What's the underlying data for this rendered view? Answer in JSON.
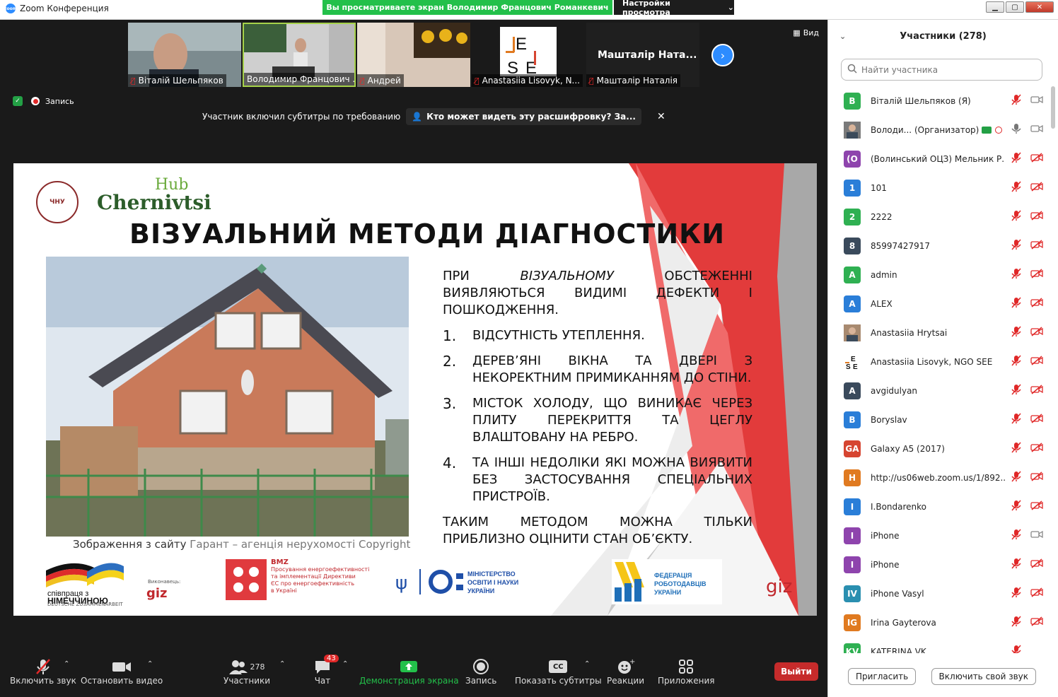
{
  "window": {
    "title": "Zoom Конференция",
    "share_banner": "Вы просматриваете экран Володимир Францович Романкевич",
    "view_settings": "Настройки просмотра"
  },
  "gallery": {
    "thumbs": [
      {
        "name": "Віталій Шельпяков",
        "muted": true
      },
      {
        "name": "Володимир Францович ...",
        "muted": false
      },
      {
        "name": "Андрей",
        "muted": true
      },
      {
        "name": "Anastasiia Lisovyk, N...",
        "muted": true
      },
      {
        "name": "Машталір Наталія",
        "muted": true,
        "big_label": "Машталір Ната..."
      }
    ],
    "view_label": "Вид"
  },
  "status": {
    "recording": "Запись",
    "subtitles_notice": "Участник включил субтитры по требованию",
    "subtitles_link": "Кто может видеть эту расшифровку? За..."
  },
  "slide": {
    "uni_logo_text": "ЧНУ",
    "hub_text": "Hub",
    "city_text": "Chernivtsi",
    "title": "ВІЗУАЛЬНИЙ МЕТОДИ ДІАГНОСТИКИ",
    "intro_pre": "ПРИ ",
    "intro_italic": "ВІЗУАЛЬНОМУ",
    "intro_post": " ОБСТЕЖЕННІ ВИЯВЛЯЮТЬСЯ ВИДИМІ ДЕФЕКТИ І ПОШКОДЖЕННЯ.",
    "items": [
      {
        "num": "1.",
        "text": "ВІДСУТНІСТЬ УТЕПЛЕННЯ."
      },
      {
        "num": "2.",
        "text": "ДЕРЕВ’ЯНІ ВІКНА ТА ДВЕРІ З НЕКОРЕКТНИМ ПРИМИКАННЯМ ДО СТІНИ."
      },
      {
        "num": "3.",
        "text": "МІСТОК ХОЛОДУ, ЩО ВИНИКАЄ ЧЕРЕЗ ПЛИТУ ПЕРЕКРИТТЯ ТА ЦЕГЛУ ВЛАШТОВАНУ НА РЕБРО."
      },
      {
        "num": "4.",
        "text": "ТА ІНШІ НЕДОЛІКИ ЯКІ МОЖНА ВИЯВИТИ БЕЗ ЗАСТОСУВАННЯ СПЕЦІАЛЬНИХ ПРИСТРОЇВ."
      }
    ],
    "conclusion": "ТАКИМ МЕТОДОМ МОЖНА ТІЛЬКИ ПРИБЛИЗНО ОЦІНИТИ СТАН ОБ’ЄКТУ.",
    "caption_prefix": "Зображення з сайту ",
    "caption_source": "Гарант – агенція нерухомості Copyright",
    "logos": {
      "coop_line1": "співпраця з",
      "coop_line2": "НІМЕЧЧИНОЮ",
      "coop_line3": "DEUTSCHE ZUSAMMENARBEIT",
      "giz_label": "Виконавець:",
      "giz": "giz",
      "bmz_title": "BMZ",
      "bmz_line1": "Просування енергоефективності",
      "bmz_line2": "та імплементації Директиви",
      "bmz_line3": "ЄС про енергоефективність",
      "bmz_line4": "в Україні",
      "mon_line1": "МІНІСТЕРСТВО",
      "mon_line2": "ОСВІТИ І НАУКИ",
      "mon_line3": "УКРАЇНИ",
      "fed_line1": "ФЕДЕРАЦІЯ",
      "fed_line2": "РОБОТОДАВЦІВ",
      "fed_line3": "УКРАЇНИ",
      "giz_corner": "giz"
    }
  },
  "toolbar": {
    "unmute": "Включить звук",
    "stop_video": "Остановить видео",
    "participants_count": "278",
    "participants": "Участники",
    "chat_badge": "43",
    "chat": "Чат",
    "share": "Демонстрация экрана",
    "record": "Запись",
    "cc_icon": "CC",
    "subtitles": "Показать субтитры",
    "reactions": "Реакции",
    "apps": "Приложения",
    "leave": "Выйти"
  },
  "participants_panel": {
    "title": "Участники (278)",
    "search_placeholder": "Найти участника",
    "invite": "Пригласить",
    "unmute_me": "Включить свой звук",
    "list": [
      {
        "initials": "В",
        "color": "#2fb052",
        "name": "Віталій Шельпяков (Я)",
        "mic": "muted",
        "video": "on"
      },
      {
        "initials": "",
        "color": "#7a7a7a",
        "name": "Володи... (Организатор)",
        "mic": "on",
        "video": "on",
        "photo": true
      },
      {
        "initials": "(О",
        "color": "#8e44ad",
        "name": "(Волинський ОЦЗ) Мельник Р...",
        "mic": "muted",
        "video": "off"
      },
      {
        "initials": "1",
        "color": "#2a7ed8",
        "name": "101",
        "mic": "muted",
        "video": "off"
      },
      {
        "initials": "2",
        "color": "#2fb052",
        "name": "2222",
        "mic": "muted",
        "video": "off"
      },
      {
        "initials": "8",
        "color": "#3a4a5c",
        "name": "85997427917",
        "mic": "muted",
        "video": "off"
      },
      {
        "initials": "A",
        "color": "#2fb052",
        "name": "admin",
        "mic": "muted",
        "video": "off"
      },
      {
        "initials": "A",
        "color": "#2a7ed8",
        "name": "ALEX",
        "mic": "muted",
        "video": "off"
      },
      {
        "initials": "",
        "color": "#a88a70",
        "name": "Anastasiia Hrytsai",
        "mic": "muted",
        "video": "off",
        "photo": true
      },
      {
        "initials": "",
        "color": "#ffffff",
        "name": "Anastasiia Lisovyk, NGO SEE",
        "mic": "muted",
        "video": "off",
        "logo": true
      },
      {
        "initials": "A",
        "color": "#3a4a5c",
        "name": "avgidulyan",
        "mic": "muted",
        "video": "off"
      },
      {
        "initials": "B",
        "color": "#2a7ed8",
        "name": "Boryslav",
        "mic": "muted",
        "video": "off"
      },
      {
        "initials": "GA",
        "color": "#d64531",
        "name": "Galaxy A5 (2017)",
        "mic": "muted",
        "video": "off"
      },
      {
        "initials": "H",
        "color": "#e07a20",
        "name": "http://us06web.zoom.us/1/892...",
        "mic": "muted",
        "video": "off"
      },
      {
        "initials": "I",
        "color": "#2a7ed8",
        "name": "I.Bondarenko",
        "mic": "muted",
        "video": "off"
      },
      {
        "initials": "I",
        "color": "#8e44ad",
        "name": "iPhone",
        "mic": "muted",
        "video": "on"
      },
      {
        "initials": "I",
        "color": "#8e44ad",
        "name": "iPhone",
        "mic": "muted",
        "video": "off"
      },
      {
        "initials": "IV",
        "color": "#2a8fb0",
        "name": "iPhone Vasyl",
        "mic": "muted",
        "video": "off"
      },
      {
        "initials": "IG",
        "color": "#e07a20",
        "name": "Irina Gayterova",
        "mic": "muted",
        "video": "off"
      },
      {
        "initials": "KV",
        "color": "#2fb052",
        "name": "KATERINA VK",
        "mic": "muted",
        "video": "none"
      }
    ]
  }
}
